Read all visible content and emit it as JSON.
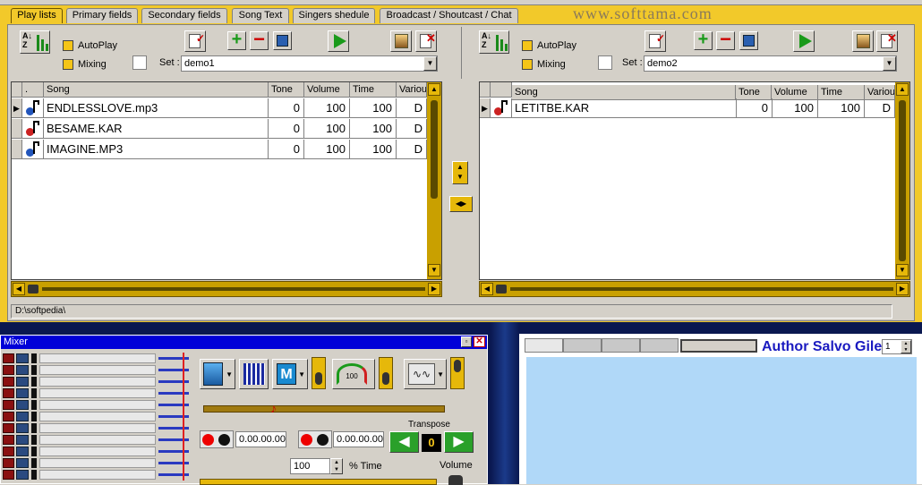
{
  "tabs": [
    "Play lists",
    "Primary fields",
    "Secondary fields",
    "Song Text",
    "Singers shedule",
    "Broadcast / Shoutcast / Chat"
  ],
  "watermark": "www.softtama.com",
  "left_panel": {
    "autoplay": "AutoPlay",
    "mixing": "Mixing",
    "set_label": "Set :",
    "set_value": "demo1"
  },
  "right_panel": {
    "autoplay": "AutoPlay",
    "mixing": "Mixing",
    "set_label": "Set :",
    "set_value": "demo2"
  },
  "grid_columns": [
    ".",
    "Song",
    "Tone",
    "Volume",
    "Time",
    "Various"
  ],
  "left_rows": [
    {
      "song": "ENDLESSLOVE.mp3",
      "tone": "0",
      "volume": "100",
      "time": "100",
      "various": "D",
      "color": "#2255bb"
    },
    {
      "song": "BESAME.KAR",
      "tone": "0",
      "volume": "100",
      "time": "100",
      "various": "D",
      "color": "#cc2222"
    },
    {
      "song": "IMAGINE.MP3",
      "tone": "0",
      "volume": "100",
      "time": "100",
      "various": "D",
      "color": "#2255bb"
    }
  ],
  "right_rows": [
    {
      "song": "LETITBE.KAR",
      "tone": "0",
      "volume": "100",
      "time": "100",
      "various": "D",
      "color": "#cc2222"
    }
  ],
  "path": "D:\\softpedia\\",
  "mixer": {
    "title": "Mixer",
    "time1": "0.00.00.00",
    "time2": "0.00.00.00",
    "transpose_label": "Transpose",
    "transpose_value": "0",
    "time_pct": "100",
    "time_pct_label": "% Time",
    "volume_label": "Volume"
  },
  "author": {
    "text": "Author Salvo Gile",
    "spin_value": "1"
  }
}
